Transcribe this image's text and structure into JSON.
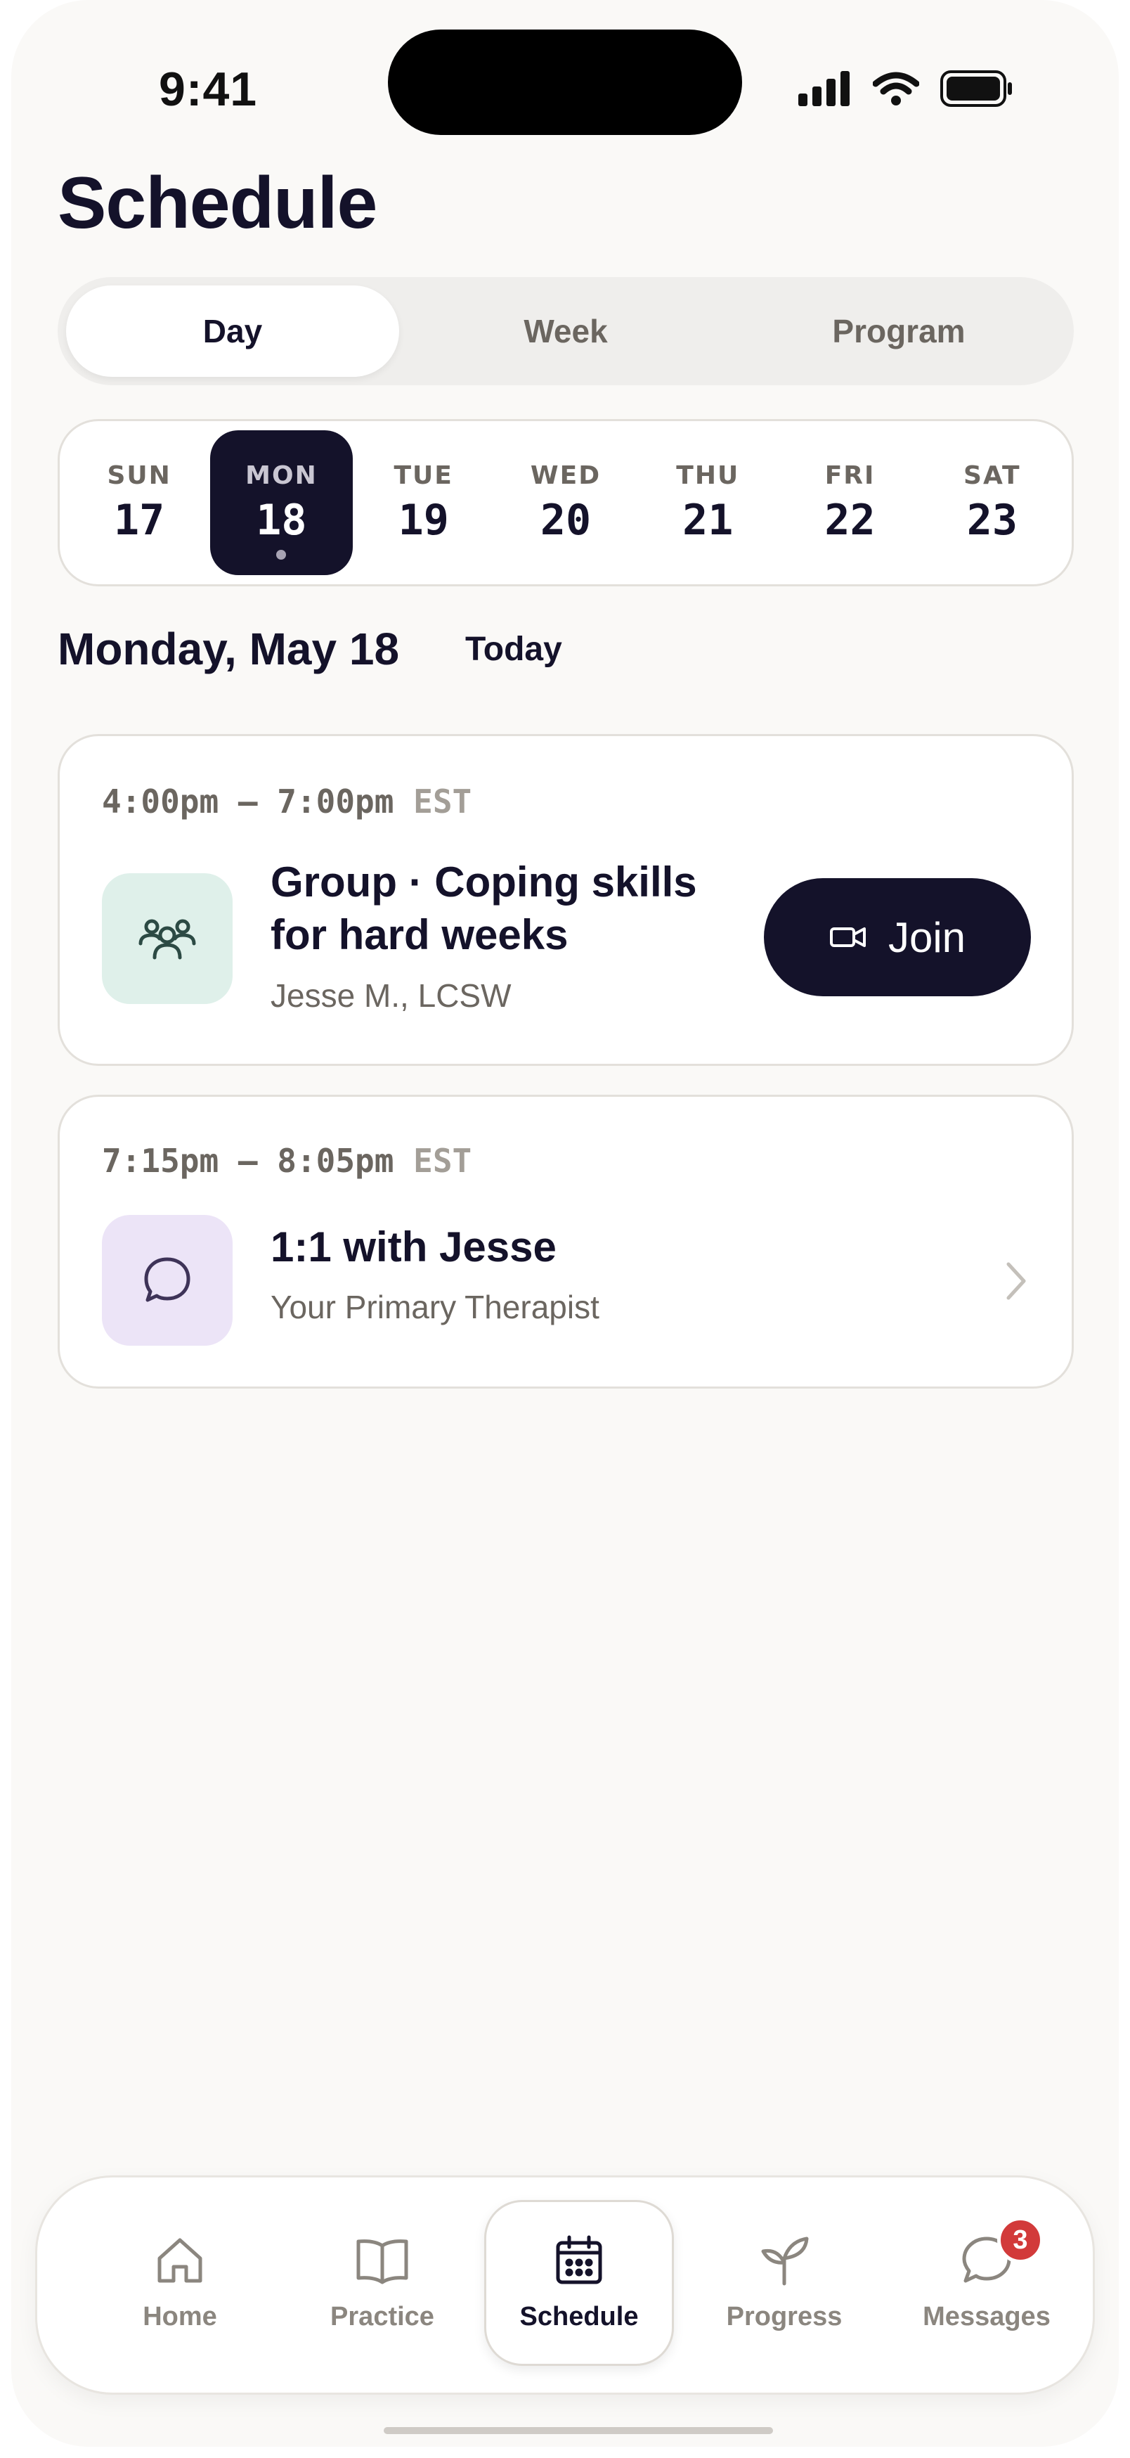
{
  "status_bar": {
    "time": "9:41"
  },
  "header": {
    "title": "Schedule"
  },
  "view_toggle": {
    "options": [
      "Day",
      "Week",
      "Program"
    ],
    "selected": "Day"
  },
  "week": {
    "days": [
      {
        "name": "SUN",
        "num": "17"
      },
      {
        "name": "MON",
        "num": "18"
      },
      {
        "name": "TUE",
        "num": "19"
      },
      {
        "name": "WED",
        "num": "20"
      },
      {
        "name": "THU",
        "num": "21"
      },
      {
        "name": "FRI",
        "num": "22"
      },
      {
        "name": "SAT",
        "num": "23"
      }
    ],
    "selected_index": 1
  },
  "date_heading": "Monday, May 18",
  "today_label": "Today",
  "sessions": [
    {
      "time": "4:00pm – 7:00pm",
      "tz": "EST",
      "title": "Group · Coping skills for hard weeks",
      "subtitle": "Jesse M., LCSW",
      "icon": "group-icon",
      "action": "Join"
    },
    {
      "time": "7:15pm – 8:05pm",
      "tz": "EST",
      "title": "1:1 with Jesse",
      "subtitle": "Your Primary Therapist",
      "icon": "chat-bubble-icon"
    }
  ],
  "tabbar": {
    "items": [
      {
        "label": "Home",
        "icon": "home-icon"
      },
      {
        "label": "Practice",
        "icon": "book-icon"
      },
      {
        "label": "Schedule",
        "icon": "calendar-icon"
      },
      {
        "label": "Progress",
        "icon": "sprout-icon"
      },
      {
        "label": "Messages",
        "icon": "message-icon",
        "badge": "3"
      }
    ],
    "active": "Schedule"
  },
  "colors": {
    "ink": "#14122a",
    "background": "#faf9f7",
    "group_tile": "#dff0ea",
    "chat_tile": "#ece4f7",
    "badge": "#d23a3a"
  }
}
